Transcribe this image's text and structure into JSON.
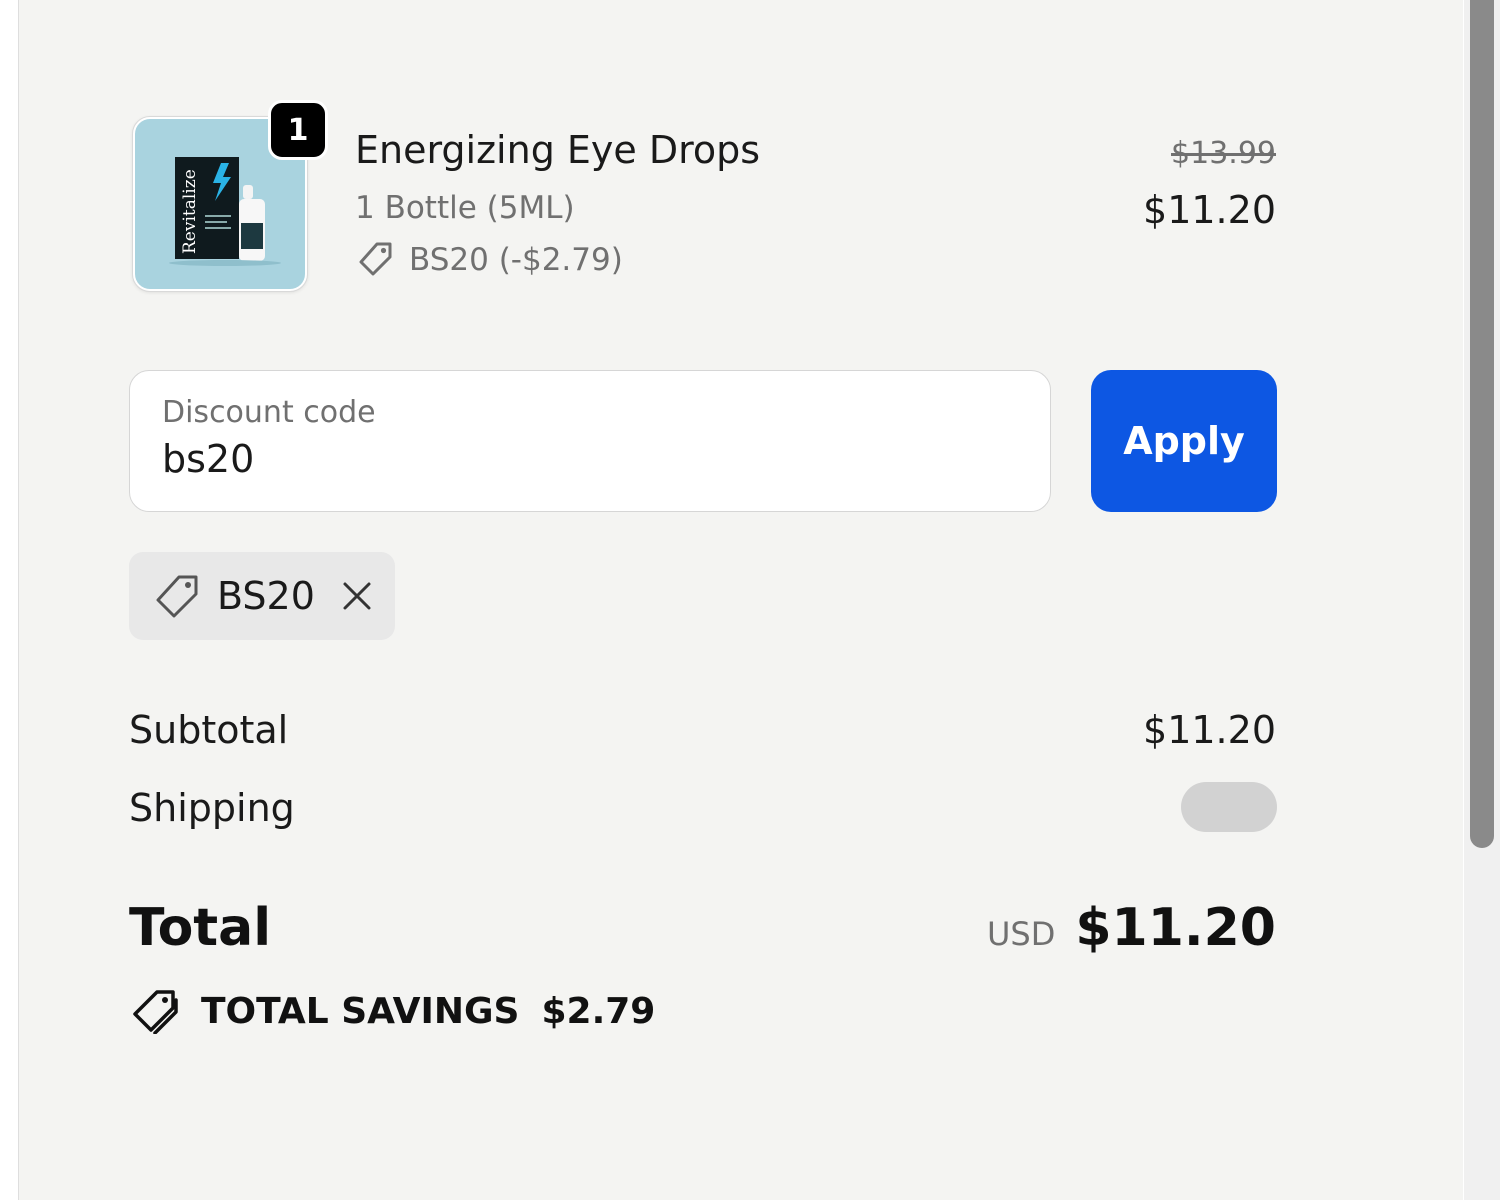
{
  "product": {
    "title": "Energizing Eye Drops",
    "variant": "1 Bottle (5ML)",
    "discount_line": "BS20 (-$2.79)",
    "quantity": "1",
    "price_original": "$13.99",
    "price_current": "$11.20",
    "image_icon": "product-image",
    "image_brand_text": "Revitalize"
  },
  "discount_form": {
    "label": "Discount code",
    "value": "bs20",
    "apply_label": "Apply"
  },
  "applied_code": {
    "code": "BS20",
    "tag_icon": "tag-icon",
    "remove_icon": "close-icon"
  },
  "summary": {
    "subtotal_label": "Subtotal",
    "subtotal_value": "$11.20",
    "shipping_label": "Shipping",
    "total_label": "Total",
    "currency": "USD",
    "total_value": "$11.20",
    "savings_label": "TOTAL SAVINGS",
    "savings_value": "$2.79",
    "savings_icon": "tags-icon"
  },
  "colors": {
    "background": "#f4f4f2",
    "accent": "#0d57e3",
    "text": "#1a1a1a",
    "muted_text": "#707070",
    "badge": "#000000",
    "product_image_bg": "#a9d3df"
  }
}
